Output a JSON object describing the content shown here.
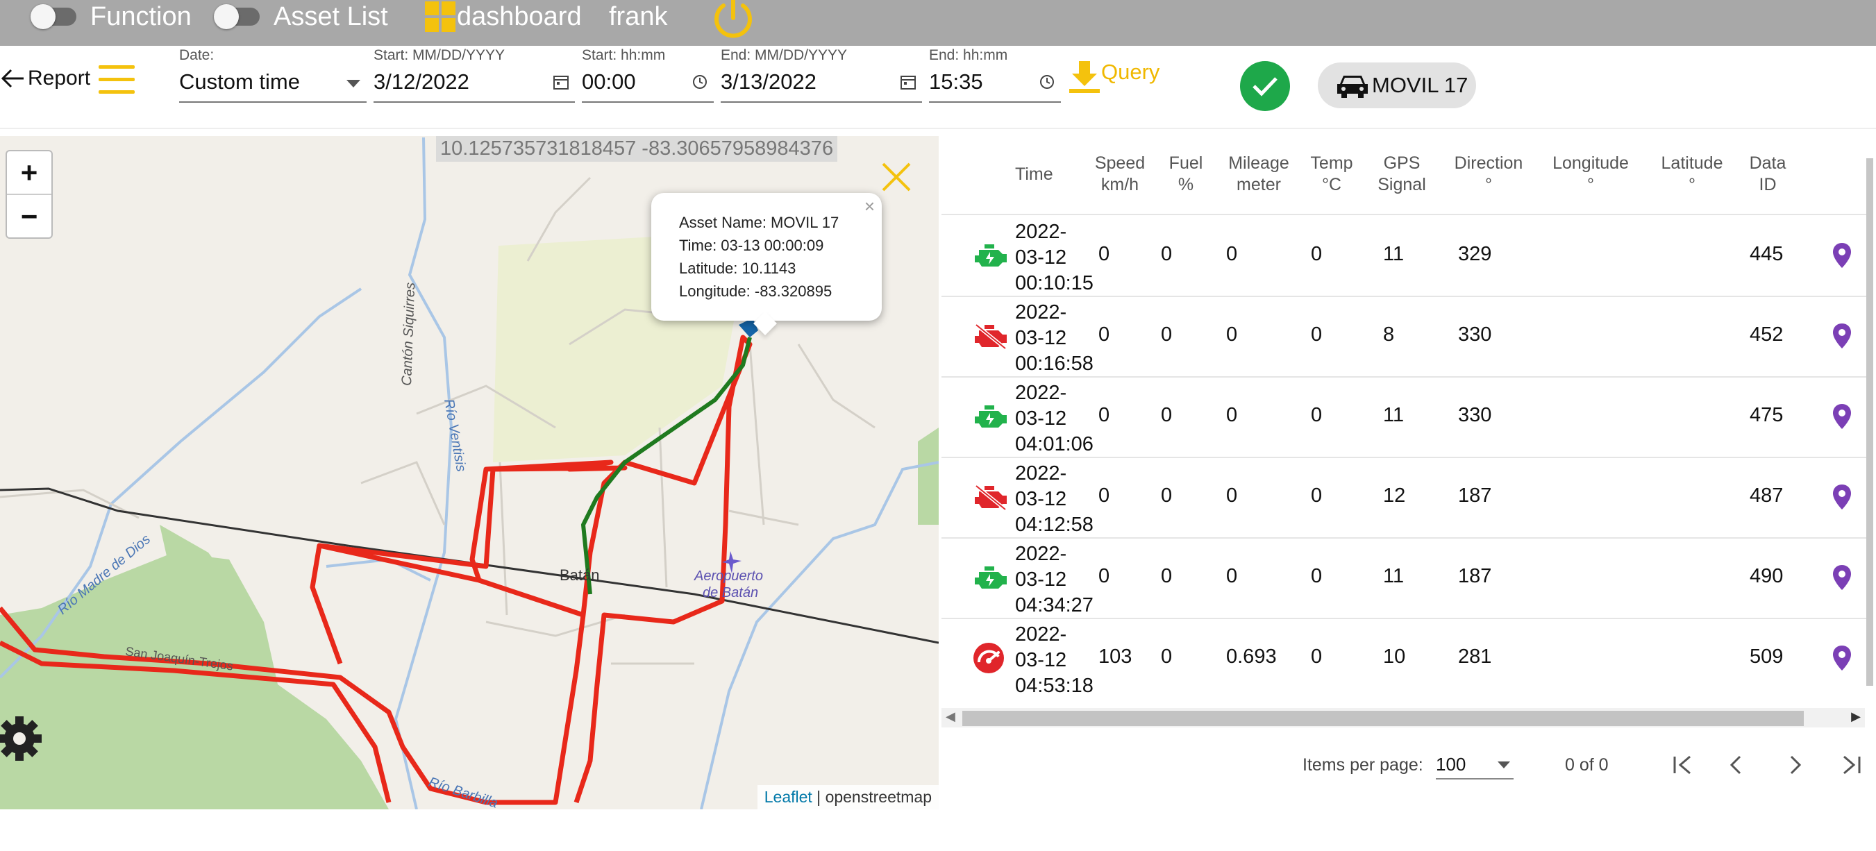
{
  "topbar": {
    "function_label": "Function",
    "asset_list_label": "Asset List",
    "dashboard_label": "dashboard",
    "user_name": "frank"
  },
  "toolbar": {
    "report_label": "Report",
    "date_label": "Date:",
    "date_value": "Custom time",
    "start_date_label": "Start: MM/DD/YYYY",
    "start_date_value": "3/12/2022",
    "start_time_label": "Start: hh:mm",
    "start_time_value": "00:00",
    "end_date_label": "End: MM/DD/YYYY",
    "end_date_value": "3/13/2022",
    "end_time_label": "End: hh:mm",
    "end_time_value": "15:35",
    "query_label": "Query",
    "vehicle_label": "MOVIL 17"
  },
  "map": {
    "coordinates": "10.125735731818457   -83.30657958984376",
    "popup": {
      "asset_name": "Asset Name: MOVIL 17",
      "time": "Time: 03-13 00:00:09",
      "latitude": "Latitude: 10.1143",
      "longitude": "Longitude: -83.320895"
    },
    "labels": {
      "canton": "Cantón Siquirres",
      "rio_ventisis": "Río Ventisis",
      "rio_madre": "Río Madre de Dios",
      "rio_barbilla": "Río Barbilla",
      "batan": "Batán",
      "aeropuerto": "Aeropuerto",
      "aeropuerto2": "de Batán",
      "joaquin": "San Joaquín-Trejos"
    },
    "attribution_leaflet": "Leaflet",
    "attribution_sep": " | ",
    "attribution_osm": "openstreetmap",
    "colors": {
      "route": "#e8281a",
      "route_recent": "#1f7a1f",
      "vegetation": "#b9d8a4"
    }
  },
  "table": {
    "headers": {
      "time": "Time",
      "speed": "Speed",
      "speed_unit": "km/h",
      "fuel": "Fuel",
      "fuel_unit": "%",
      "mileage": "Mileage",
      "mileage_unit": "meter",
      "temp": "Temp",
      "temp_unit": "°C",
      "gps": "GPS",
      "gps_unit": "Signal",
      "direction": "Direction",
      "direction_unit": "°",
      "longitude": "Longitude",
      "longitude_unit": "°",
      "latitude": "Latitude",
      "latitude_unit": "°",
      "dataid": "Data",
      "dataid_unit": "ID"
    },
    "rows": [
      {
        "status": "engine-on",
        "t1": "2022-",
        "t2": "03-12",
        "t3": "00:10:15",
        "speed": "0",
        "fuel": "0",
        "mileage": "0",
        "temp": "0",
        "gps": "11",
        "direction": "329",
        "data_id": "445"
      },
      {
        "status": "engine-off",
        "t1": "2022-",
        "t2": "03-12",
        "t3": "00:16:58",
        "speed": "0",
        "fuel": "0",
        "mileage": "0",
        "temp": "0",
        "gps": "8",
        "direction": "330",
        "data_id": "452"
      },
      {
        "status": "engine-on",
        "t1": "2022-",
        "t2": "03-12",
        "t3": "04:01:06",
        "speed": "0",
        "fuel": "0",
        "mileage": "0",
        "temp": "0",
        "gps": "11",
        "direction": "330",
        "data_id": "475"
      },
      {
        "status": "engine-off",
        "t1": "2022-",
        "t2": "03-12",
        "t3": "04:12:58",
        "speed": "0",
        "fuel": "0",
        "mileage": "0",
        "temp": "0",
        "gps": "12",
        "direction": "187",
        "data_id": "487"
      },
      {
        "status": "engine-on",
        "t1": "2022-",
        "t2": "03-12",
        "t3": "04:34:27",
        "speed": "0",
        "fuel": "0",
        "mileage": "0",
        "temp": "0",
        "gps": "11",
        "direction": "187",
        "data_id": "490"
      },
      {
        "status": "speeding",
        "t1": "2022-",
        "t2": "03-12",
        "t3": "04:53:18",
        "speed": "103",
        "fuel": "0",
        "mileage": "0.693",
        "temp": "0",
        "gps": "10",
        "direction": "281",
        "data_id": "509"
      }
    ],
    "colors": {
      "engine_on": "#22b24c",
      "engine_off": "#e0262b",
      "pin": "#7b3fb5"
    }
  },
  "pager": {
    "items_per_page_label": "Items per page:",
    "items_per_page_value": "100",
    "range_label": "0 of 0"
  }
}
